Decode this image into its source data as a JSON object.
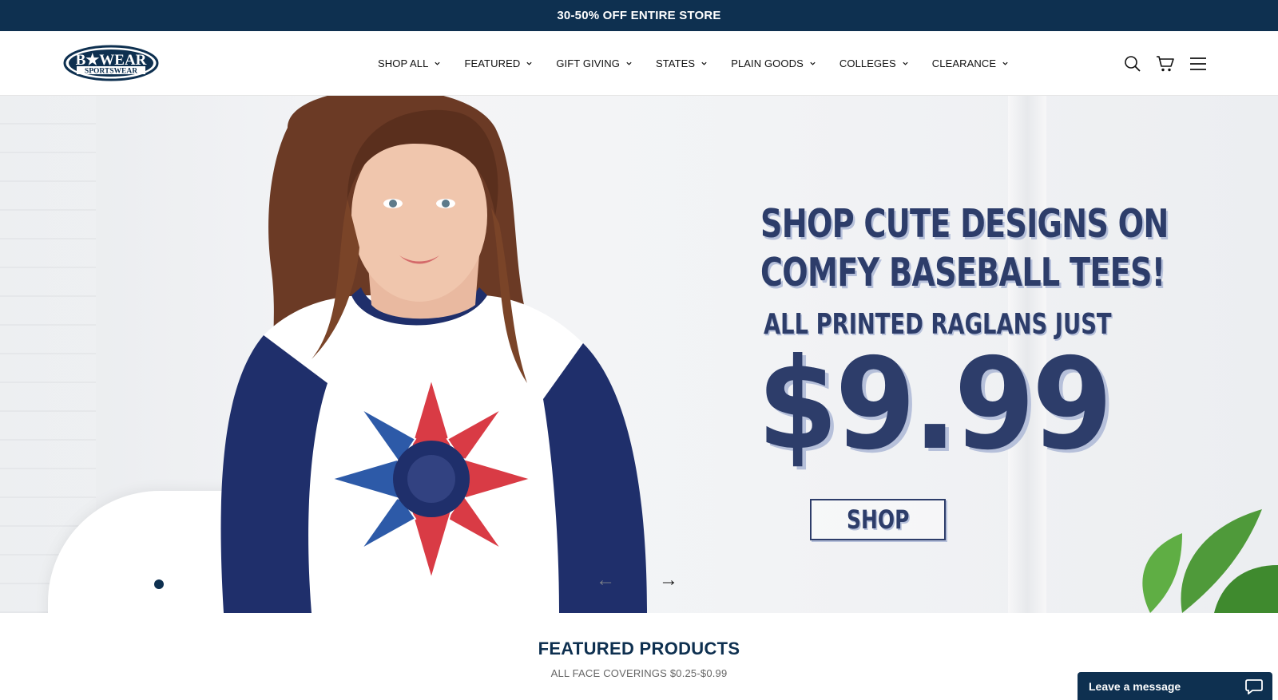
{
  "announcement": {
    "text": "30-50% OFF ENTIRE STORE"
  },
  "brand": {
    "logo_top": "B★WEAR",
    "logo_bottom": "SPORTSWEAR",
    "accent": "#0e3050"
  },
  "nav": {
    "items": [
      {
        "label": "SHOP ALL"
      },
      {
        "label": "FEATURED"
      },
      {
        "label": "GIFT GIVING"
      },
      {
        "label": "STATES"
      },
      {
        "label": "PLAIN GOODS"
      },
      {
        "label": "COLLEGES"
      },
      {
        "label": "CLEARANCE"
      }
    ]
  },
  "header_icons": [
    "search-icon",
    "cart-icon",
    "menu-icon"
  ],
  "hero": {
    "line1": "SHOP CUTE DESIGNS ON",
    "line2": "COMFY BASEBALL TEES!",
    "line3": "ALL PRINTED RAGLANS JUST",
    "price": "$9.99",
    "cta": "SHOP",
    "text_color": "#2d3d6a",
    "slides_total": 4,
    "active_slide": 3,
    "prev_arrow": "←",
    "next_arrow": "→"
  },
  "featured": {
    "title": "FEATURED PRODUCTS",
    "subtitle": "ALL FACE COVERINGS $0.25-$0.99"
  },
  "chat": {
    "label": "Leave a message"
  }
}
